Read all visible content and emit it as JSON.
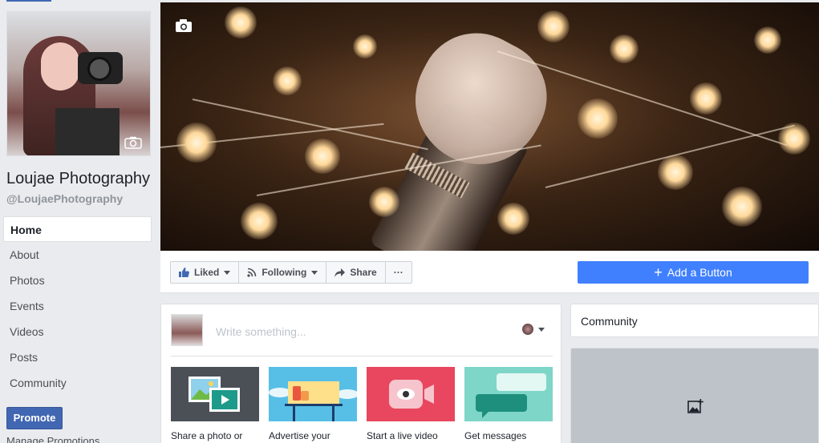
{
  "page": {
    "name": "Loujae Photography",
    "handle": "@LoujaePhotography"
  },
  "nav": {
    "items": [
      {
        "label": "Home",
        "active": true
      },
      {
        "label": "About"
      },
      {
        "label": "Photos"
      },
      {
        "label": "Events"
      },
      {
        "label": "Videos"
      },
      {
        "label": "Posts"
      },
      {
        "label": "Community"
      }
    ],
    "promote_label": "Promote",
    "manage_promotions_label": "Manage Promotions"
  },
  "actions": {
    "liked_label": "Liked",
    "following_label": "Following",
    "share_label": "Share",
    "more_label": "···",
    "add_button_label": "Add a Button",
    "add_button_plus": "+"
  },
  "composer": {
    "placeholder": "Write something...",
    "tiles": [
      {
        "label": "Share a photo or",
        "icon": "photo-video-icon"
      },
      {
        "label": "Advertise your",
        "icon": "billboard-icon"
      },
      {
        "label": "Start a live video",
        "icon": "live-video-icon"
      },
      {
        "label": "Get messages",
        "icon": "messages-icon"
      }
    ]
  },
  "sidebar_right": {
    "community_title": "Community"
  },
  "colors": {
    "brand": "#4267b2",
    "add_button": "#4080ff",
    "background": "#e9ebee"
  }
}
